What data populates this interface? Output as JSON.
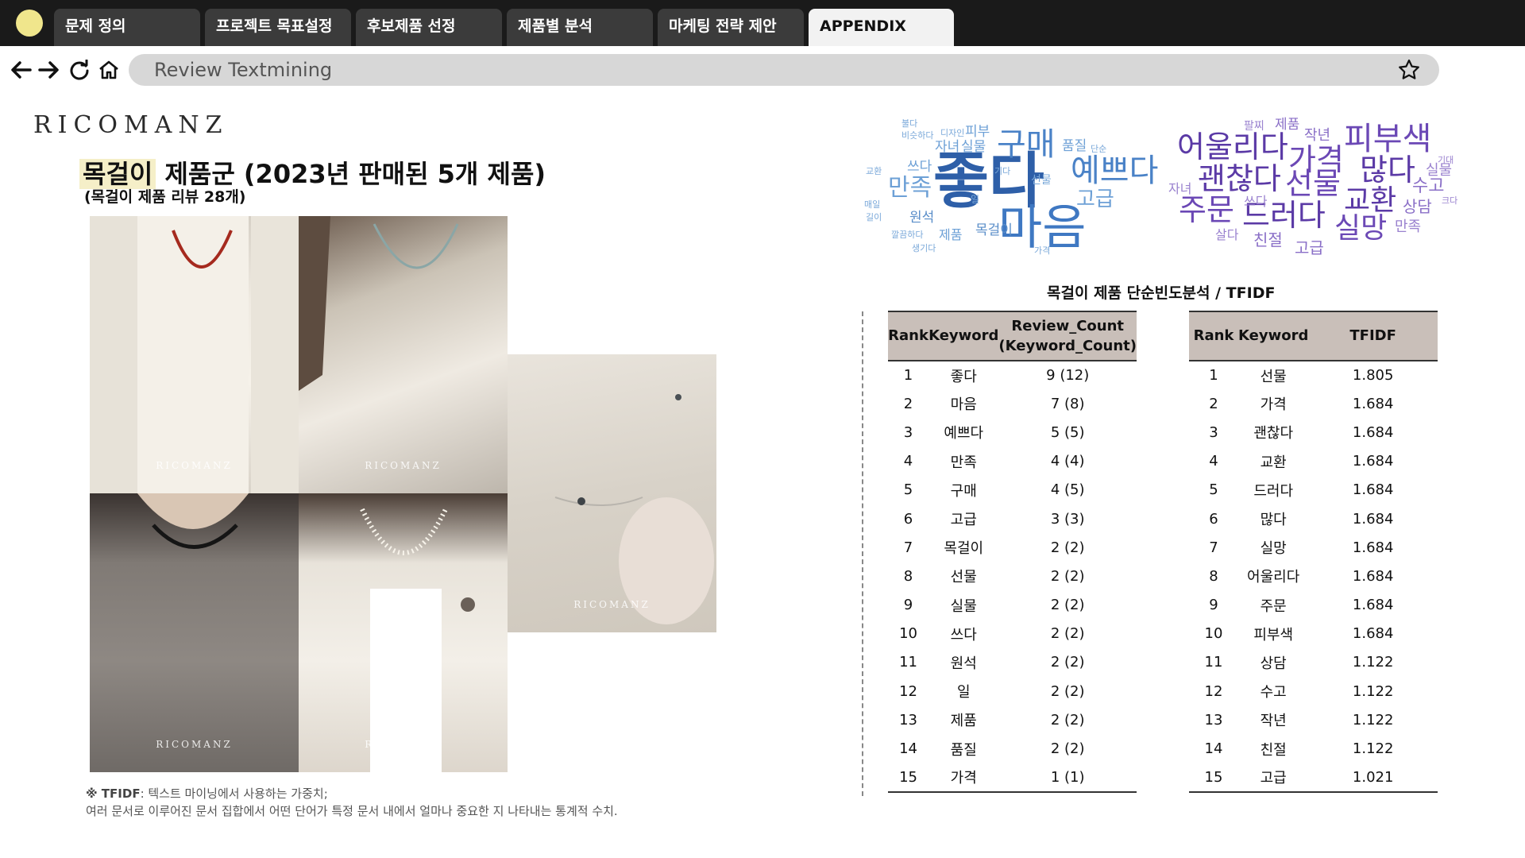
{
  "tabs": [
    {
      "label": "문제 정의",
      "active": false
    },
    {
      "label": "프로젝트 목표설정",
      "active": false
    },
    {
      "label": "후보제품 선정",
      "active": false
    },
    {
      "label": "제품별 분석",
      "active": false
    },
    {
      "label": "마케팅 전략 제안",
      "active": false
    },
    {
      "label": "APPENDIX",
      "active": true
    }
  ],
  "address_bar": {
    "text": "Review Textmining"
  },
  "logo": "RICOMANZ",
  "heading": {
    "highlight": "목걸이",
    "rest": " 제품군 (2023년 판매된 5개 제품)"
  },
  "subheading": "(목걸이 제품 리뷰 28개)",
  "photo_watermark": "RICOMANZ",
  "notes": {
    "tfidf_term": "※ TFIDF",
    "line1": ": 텍스트 마이닝에서 사용하는 가중치;",
    "line2": "여러 문서로 이루어진 문서 집합에서 어떤 단어가 특정 문서 내에서 얼마나 중요한 지 나타내는 통계적 수치."
  },
  "wordcloud_freq": [
    "좋다",
    "마음",
    "예쁘다",
    "구매",
    "만족",
    "고급",
    "목걸이",
    "선물",
    "쓰다",
    "원석",
    "제품",
    "품질",
    "자녀",
    "실물",
    "피부",
    "가격",
    "디자인",
    "비슷하다",
    "교환",
    "매일",
    "길이",
    "일",
    "기다",
    "깔끔하다",
    "생기다",
    "단순",
    "불다"
  ],
  "wordcloud_tfidf": [
    "어울리다",
    "가격",
    "많다",
    "피부색",
    "괜찮다",
    "선물",
    "교환",
    "주문",
    "드러다",
    "실망",
    "작년",
    "제품",
    "팔찌",
    "친절",
    "살다",
    "고급",
    "자녀",
    "쓰다",
    "수고",
    "실물",
    "상담",
    "만족",
    "기대",
    "크다"
  ],
  "tables_title": "목걸이 제품 단순빈도분석 / TFIDF",
  "freq_table": {
    "headers": {
      "rank": "Rank",
      "keyword": "Keyword",
      "count_line1": "Review_Count",
      "count_line2": "(Keyword_Count)"
    },
    "rows": [
      [
        "1",
        "좋다",
        "9 (12)"
      ],
      [
        "2",
        "마음",
        "7 (8)"
      ],
      [
        "3",
        "예쁘다",
        "5 (5)"
      ],
      [
        "4",
        "만족",
        "4 (4)"
      ],
      [
        "5",
        "구매",
        "4 (5)"
      ],
      [
        "6",
        "고급",
        "3 (3)"
      ],
      [
        "7",
        "목걸이",
        "2 (2)"
      ],
      [
        "8",
        "선물",
        "2 (2)"
      ],
      [
        "9",
        "실물",
        "2 (2)"
      ],
      [
        "10",
        "쓰다",
        "2 (2)"
      ],
      [
        "11",
        "원석",
        "2 (2)"
      ],
      [
        "12",
        "일",
        "2 (2)"
      ],
      [
        "13",
        "제품",
        "2 (2)"
      ],
      [
        "14",
        "품질",
        "2 (2)"
      ],
      [
        "15",
        "가격",
        "1 (1)"
      ]
    ]
  },
  "tfidf_table": {
    "headers": {
      "rank": "Rank",
      "keyword": "Keyword",
      "score": "TFIDF"
    },
    "rows": [
      [
        "1",
        "선물",
        "1.805"
      ],
      [
        "2",
        "가격",
        "1.684"
      ],
      [
        "3",
        "괜찮다",
        "1.684"
      ],
      [
        "4",
        "교환",
        "1.684"
      ],
      [
        "5",
        "드러다",
        "1.684"
      ],
      [
        "6",
        "많다",
        "1.684"
      ],
      [
        "7",
        "실망",
        "1.684"
      ],
      [
        "8",
        "어울리다",
        "1.684"
      ],
      [
        "9",
        "주문",
        "1.684"
      ],
      [
        "10",
        "피부색",
        "1.684"
      ],
      [
        "11",
        "상담",
        "1.122"
      ],
      [
        "12",
        "수고",
        "1.122"
      ],
      [
        "13",
        "작년",
        "1.122"
      ],
      [
        "14",
        "친절",
        "1.122"
      ],
      [
        "15",
        "고급",
        "1.021"
      ]
    ]
  },
  "colors": {
    "tab_bg": "#3b3b3b",
    "tab_active_bg": "#f2f2f2",
    "header_bg": "#c9bfb9",
    "cloud_blue": "#2e5fa8",
    "cloud_purple": "#5b3aa6"
  },
  "icons": {
    "back": "arrow-left-icon",
    "forward": "arrow-right-icon",
    "reload": "reload-icon",
    "home": "home-icon",
    "bookmark": "star-icon"
  }
}
